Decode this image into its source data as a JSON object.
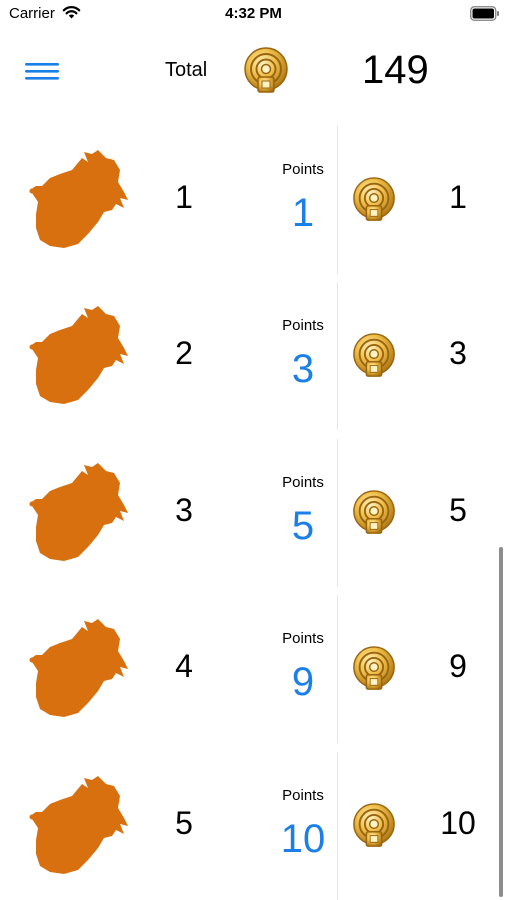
{
  "status_bar": {
    "carrier": "Carrier",
    "time": "4:32 PM"
  },
  "header": {
    "total_label": "Total",
    "total_value": "149"
  },
  "icons": {
    "menu": "hamburger-menu-icon",
    "coin": "gold-coin-icon",
    "silhouette": "animal-head-silhouette-icon"
  },
  "colors": {
    "accent": "#1a7fe6",
    "silhouette": "#d9700f",
    "coin_gold": "#e0a52a"
  },
  "rows": [
    {
      "index": "1",
      "points_label": "Points",
      "points": "1",
      "coins": "1"
    },
    {
      "index": "2",
      "points_label": "Points",
      "points": "3",
      "coins": "3"
    },
    {
      "index": "3",
      "points_label": "Points",
      "points": "5",
      "coins": "5"
    },
    {
      "index": "4",
      "points_label": "Points",
      "points": "9",
      "coins": "9"
    },
    {
      "index": "5",
      "points_label": "Points",
      "points": "10",
      "coins": "10"
    }
  ]
}
